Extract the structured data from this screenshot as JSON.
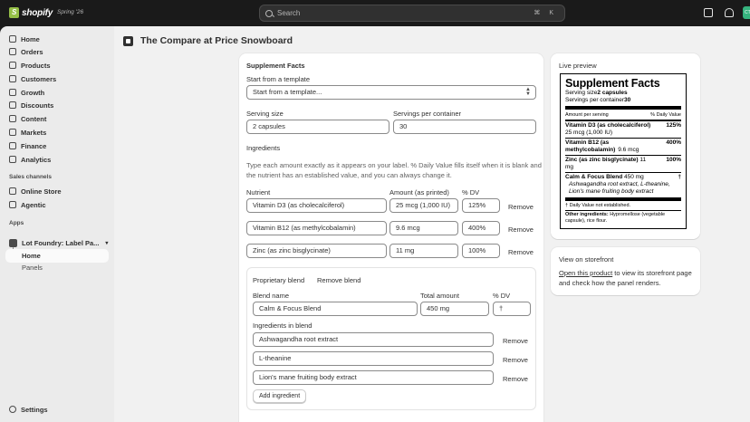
{
  "topbar": {
    "brand": "shopify",
    "edition": "Spring '26",
    "search_placeholder": "Search",
    "search_shortcut": "⌘ K",
    "avatar_initials": "CT"
  },
  "sidebar": {
    "items": [
      {
        "label": "Home",
        "icon": "home-icon"
      },
      {
        "label": "Orders",
        "icon": "orders-icon"
      },
      {
        "label": "Products",
        "icon": "products-icon"
      },
      {
        "label": "Customers",
        "icon": "customers-icon"
      },
      {
        "label": "Growth",
        "icon": "growth-icon"
      },
      {
        "label": "Discounts",
        "icon": "discounts-icon"
      },
      {
        "label": "Content",
        "icon": "content-icon"
      },
      {
        "label": "Markets",
        "icon": "markets-icon"
      },
      {
        "label": "Finance",
        "icon": "finance-icon"
      },
      {
        "label": "Analytics",
        "icon": "analytics-icon"
      }
    ],
    "sales_channels_label": "Sales channels",
    "channels": [
      "Online Store",
      "Agentic"
    ],
    "apps_label": "Apps",
    "app_name": "Lot Foundry: Label Pa...",
    "app_sub_active": "Home",
    "app_sub_item": "Panels",
    "settings": "Settings"
  },
  "page": {
    "title": "The Compare at Price Snowboard"
  },
  "form": {
    "section_title": "Supplement Facts",
    "template_label": "Start from a template",
    "template_value": "Start from a template...",
    "serving_size_label": "Serving size",
    "serving_size_value": "2 capsules",
    "servings_label": "Servings per container",
    "servings_value": "30",
    "ingredients_title": "Ingredients",
    "help_text_1": "Type each amount exactly as it appears on your label. % Daily Value fills itself when it is blank and",
    "help_text_2": "the nutrient has an established value, and you can always change it.",
    "col_nutrient": "Nutrient",
    "col_amount": "Amount (as printed)",
    "col_dv": "% DV",
    "remove_label": "Remove",
    "nutrients": [
      {
        "name": "Vitamin D3 (as cholecalciferol)",
        "amount": "25 mcg (1,000 IU)",
        "dv": "125%"
      },
      {
        "name": "Vitamin B12 (as methylcobalamin)",
        "amount": "9.6 mcg",
        "dv": "400%"
      },
      {
        "name": "Zinc (as zinc bisglycinate)",
        "amount": "11 mg",
        "dv": "100%"
      }
    ],
    "blend": {
      "title": "Proprietary blend",
      "remove_blend": "Remove blend",
      "name_label": "Blend name",
      "name_value": "Calm & Focus Blend",
      "total_label": "Total amount",
      "total_value": "450 mg",
      "dv_label": "% DV",
      "dv_value": "†",
      "ingredients_label": "Ingredients in blend",
      "ingredients": [
        "Ashwagandha root extract",
        "L-theanine",
        "Lion's mane fruiting body extract"
      ],
      "add_label": "Add ingredient"
    }
  },
  "preview": {
    "title": "Live preview",
    "facts_title": "Supplement Facts",
    "serving_size_prefix": "Serving size ",
    "serving_size": "2 capsules",
    "servings_prefix": "Servings per container ",
    "servings": "30",
    "amount_per_serving": "Amount per serving",
    "daily_value_head": "% Daily Value",
    "rows": [
      {
        "name": "Vitamin D3 (as cholecalciferol)",
        "sub": "25 mcg (1,000 IU)",
        "dv": "125%"
      },
      {
        "name": "Vitamin B12 (as",
        "name2": "methylcobalamin)",
        "amt": "9.6 mcg",
        "dv": "400%"
      },
      {
        "name": "Zinc (as zinc bisglycinate)",
        "amt": "11",
        "amt2": "mg",
        "dv": "100%"
      }
    ],
    "blend_name": "Calm & Focus Blend",
    "blend_amount": "450 mg",
    "blend_dv": "†",
    "blend_line1": "Ashwagandha root extract, L-theanine,",
    "blend_line2": "Lion's mane fruiting body extract",
    "footnote": "† Daily Value not established.",
    "other_label": "Other ingredients:",
    "other_text1": "Hypromellose (vegetable",
    "other_text2": "capsule), rice flour."
  },
  "storefront": {
    "title": "View on storefront",
    "link": "Open this product",
    "text1": " to view its storefront page",
    "text2": "and check how the panel renders."
  }
}
